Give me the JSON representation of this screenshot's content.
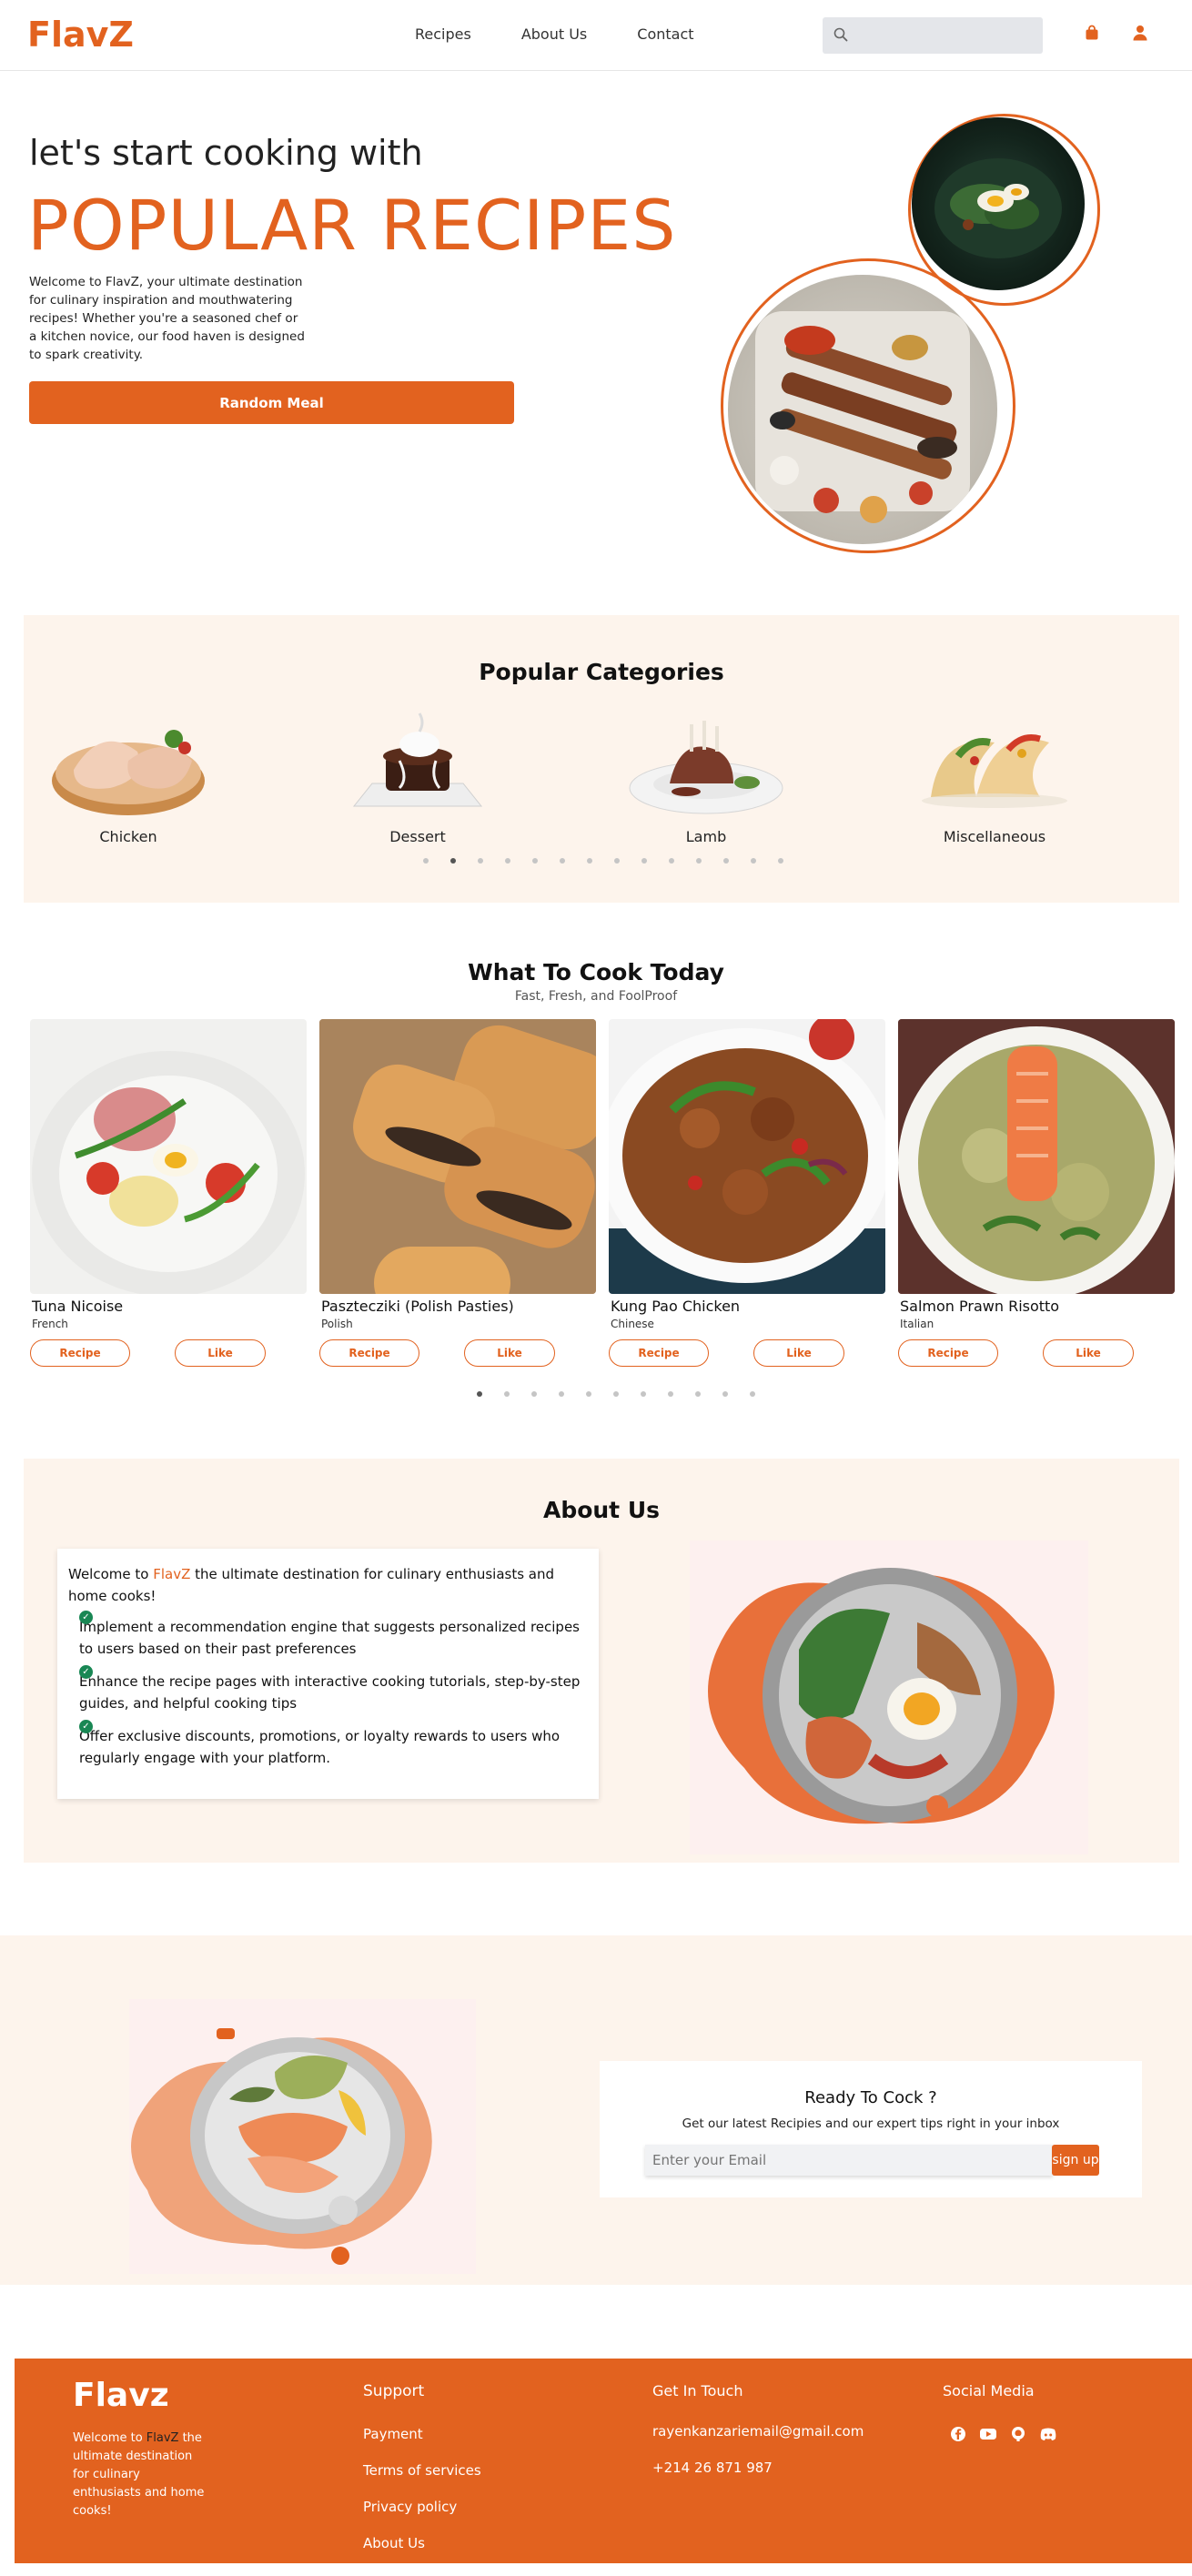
{
  "nav": {
    "logo": "FlavZ",
    "links": [
      "Recipes",
      "About Us",
      "Contact"
    ],
    "search_placeholder": "",
    "icons": [
      "search-icon",
      "shopping-bag-icon",
      "user-icon"
    ],
    "accent": "#e2621f"
  },
  "hero": {
    "tagline": "let's start cooking with",
    "headline": "POPULAR RECIPES",
    "description": "Welcome to FlavZ, your ultimate destination for culinary inspiration and mouthwatering recipes! Whether you're a seasoned chef or a kitchen novice, our food haven is designed to spark creativity.",
    "button": "Random Meal"
  },
  "categories": {
    "title": "Popular Categories",
    "items": [
      "Chicken",
      "Dessert",
      "Lamb",
      "Miscellaneous"
    ],
    "dot_count": 14,
    "active_dot": 1
  },
  "cook": {
    "title": "What To Cook Today",
    "subtitle": "Fast, Fresh, and FoolProof",
    "cards": [
      {
        "name": "Tuna Nicoise",
        "area": "French",
        "recipe": "Recipe",
        "like": "Like"
      },
      {
        "name": "Pasztecziki (Polish Pasties)",
        "area": "Polish",
        "recipe": "Recipe",
        "like": "Like"
      },
      {
        "name": "Kung Pao Chicken",
        "area": "Chinese",
        "recipe": "Recipe",
        "like": "Like"
      },
      {
        "name": "Salmon Prawn Risotto",
        "area": "Italian",
        "recipe": "Recipe",
        "like": "Like"
      }
    ],
    "dot_count": 11,
    "active_dot": 0
  },
  "about": {
    "title": "About Us",
    "intro_before": "Welcome to ",
    "intro_brand": "FlavZ",
    "intro_after": " the ultimate destination for culinary enthusiasts and home cooks!",
    "points": [
      "Implement a recommendation engine that suggests personalized recipes to users based on their past preferences",
      "Enhance the recipe pages with interactive cooking tutorials, step-by-step guides, and helpful cooking tips",
      "Offer exclusive discounts, promotions, or loyalty rewards to users who regularly engage with your platform."
    ]
  },
  "newsletter": {
    "title": "Ready To Cock ?",
    "subtitle": "Get our latest Recipies and our expert tips right in your inbox",
    "placeholder": "Enter your Email",
    "button": "sign up"
  },
  "footer": {
    "logo": "Flavz",
    "desc_before": "Welcome to ",
    "desc_brand": "FlavZ",
    "desc_after": " the ultimate destination for culinary enthusiasts and home cooks!",
    "support_title": "Support",
    "support_links": [
      "Payment",
      "Terms of services",
      "Privacy policy",
      "About Us"
    ],
    "contact_title": "Get In Touch",
    "email": "rayenkanzariemail@gmail.com",
    "phone": "+214 26 871 987",
    "social_title": "Social Media",
    "social_icons": [
      "facebook-icon",
      "youtube-icon",
      "github-icon",
      "discord-icon"
    ]
  }
}
